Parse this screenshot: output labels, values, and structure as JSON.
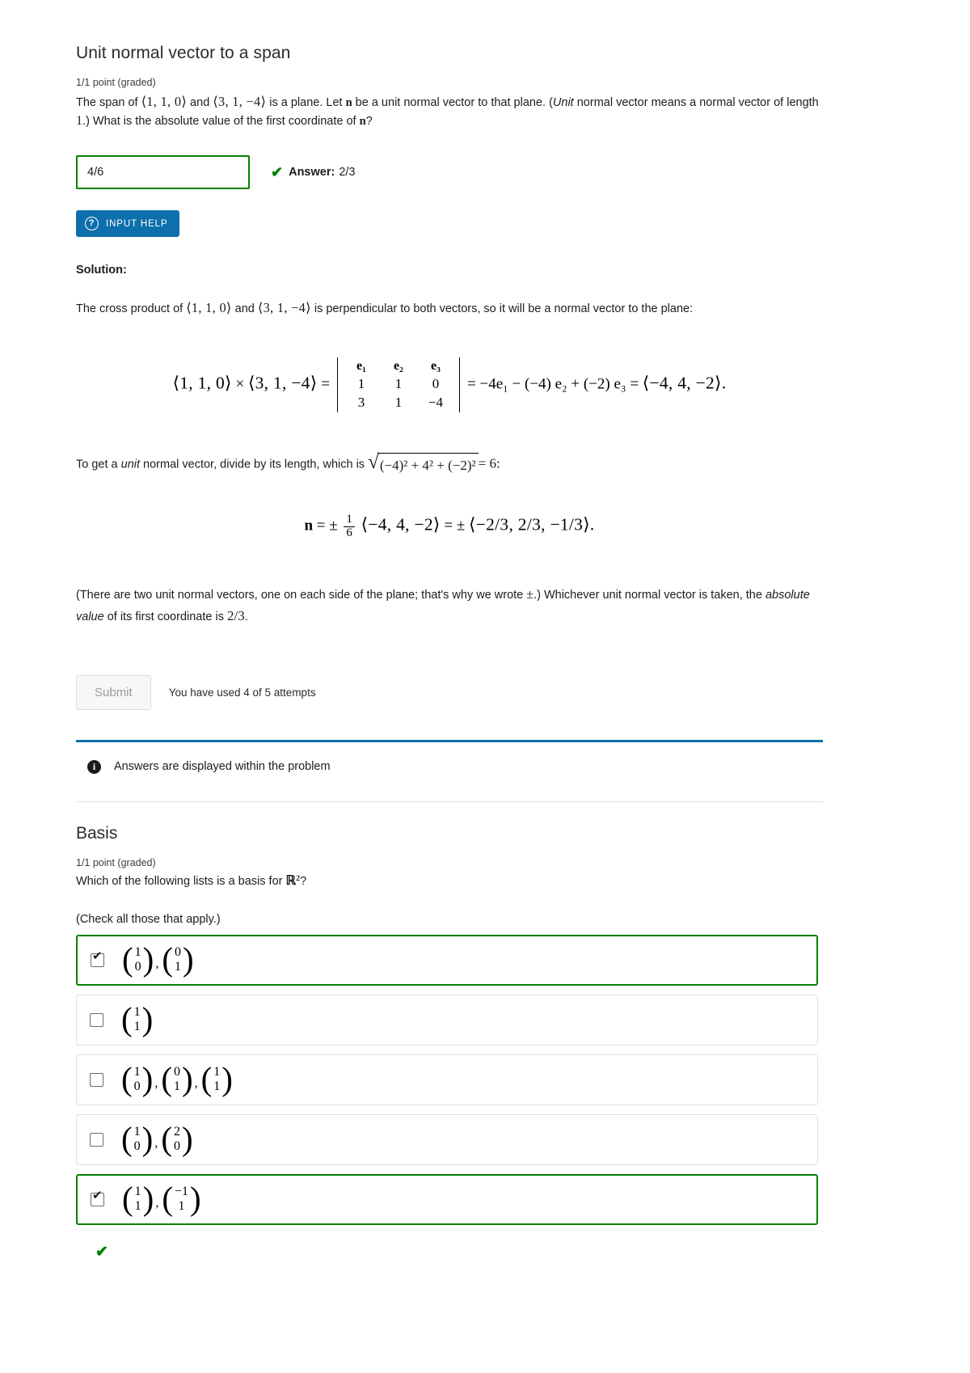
{
  "problem1": {
    "title": "Unit normal vector to a span",
    "points": "1/1 point (graded)",
    "prompt_p1": "The span of ",
    "prompt_v1": "⟨1, 1, 0⟩",
    "prompt_p2": " and ",
    "prompt_v2": "⟨3, 1, −4⟩",
    "prompt_p3": " is a plane. Let ",
    "prompt_n1": "n",
    "prompt_p4": " be a unit normal vector to that plane. (",
    "prompt_unit_italic": "Unit",
    "prompt_p5": " normal vector means a normal vector of length ",
    "prompt_one": "1",
    "prompt_p6": ".) What is the absolute value of the first coordinate of ",
    "prompt_n2": "n",
    "prompt_p7": "?",
    "answer_input_value": "4/6",
    "answer_label": "Answer:",
    "answer_value": "2/3",
    "check_icon": "check-icon",
    "input_help_label": "INPUT HELP",
    "input_help_icon": "question-mark-icon",
    "solution_heading": "Solution:",
    "solution_line1_a": "The cross product of ",
    "solution_line1_v1": "⟨1, 1, 0⟩",
    "solution_line1_b": " and ",
    "solution_line1_v2": "⟨3, 1, −4⟩",
    "solution_line1_c": " is perpendicular to both vectors, so it will be a normal vector to the plane:",
    "cross_lhs_v1": "⟨1, 1, 0⟩",
    "cross_times": "×",
    "cross_lhs_v2": "⟨3, 1, −4⟩",
    "cross_eq1": "=",
    "det_row1": [
      "e₁",
      "e₂",
      "e₃"
    ],
    "det_row2": [
      "1",
      "1",
      "0"
    ],
    "det_row3": [
      "3",
      "1",
      "−4"
    ],
    "cross_eq2": "=",
    "cross_expand": "−4e₁ − (−4) e₂ + (−2) e₃",
    "cross_eq3": "=",
    "cross_result": "⟨−4, 4, −2⟩.",
    "length_line_a": "To get a ",
    "length_line_unit": "unit",
    "length_line_b": " normal vector, divide by its length, which is ",
    "sqrt_body": "(−4)² + 4² + (−2)²",
    "length_eq": "= 6:",
    "n_symbol": "n",
    "n_eq": "= ±",
    "frac_num": "1",
    "frac_den": "6",
    "n_vec1": "⟨−4, 4, −2⟩",
    "n_eq2": "= ±",
    "n_vec2": "⟨−2/3, 2/3, −1/3⟩.",
    "closing_a": "(There are two unit normal vectors, one on each side of the plane; that's why we wrote ",
    "closing_pm": "±",
    "closing_b": ".) Whichever unit normal vector is taken, the ",
    "closing_italic": "absolute value",
    "closing_c": " of its first coordinate is ",
    "closing_value": "2/3",
    "closing_d": ".",
    "submit_label": "Submit",
    "attempts_text": "You have used 4 of 5 attempts"
  },
  "notification": {
    "icon": "info-icon",
    "text": "Answers are displayed within the problem",
    "accent_color": "#0d6fab"
  },
  "problem2": {
    "title": "Basis",
    "points": "1/1 point (graded)",
    "question_a": "Which of the following lists is a basis for ",
    "question_R": "ℝ",
    "question_exp": "2",
    "question_b": "?",
    "check_note": "(Check all those that apply.)",
    "choices": [
      {
        "checked": true,
        "correct": true,
        "vectors": [
          [
            "1",
            "0"
          ],
          [
            "0",
            "1"
          ]
        ]
      },
      {
        "checked": false,
        "correct": false,
        "vectors": [
          [
            "1",
            "1"
          ]
        ]
      },
      {
        "checked": false,
        "correct": false,
        "vectors": [
          [
            "1",
            "0"
          ],
          [
            "0",
            "1"
          ],
          [
            "1",
            "1"
          ]
        ]
      },
      {
        "checked": false,
        "correct": false,
        "vectors": [
          [
            "1",
            "0"
          ],
          [
            "2",
            "0"
          ]
        ]
      },
      {
        "checked": true,
        "correct": true,
        "vectors": [
          [
            "1",
            "1"
          ],
          [
            "−1",
            "1"
          ]
        ]
      }
    ],
    "final_check_icon": "check-icon"
  },
  "colors": {
    "correct_green": "#008100",
    "accent_blue": "#0d6fab",
    "border_gray": "#e0e0e0"
  }
}
